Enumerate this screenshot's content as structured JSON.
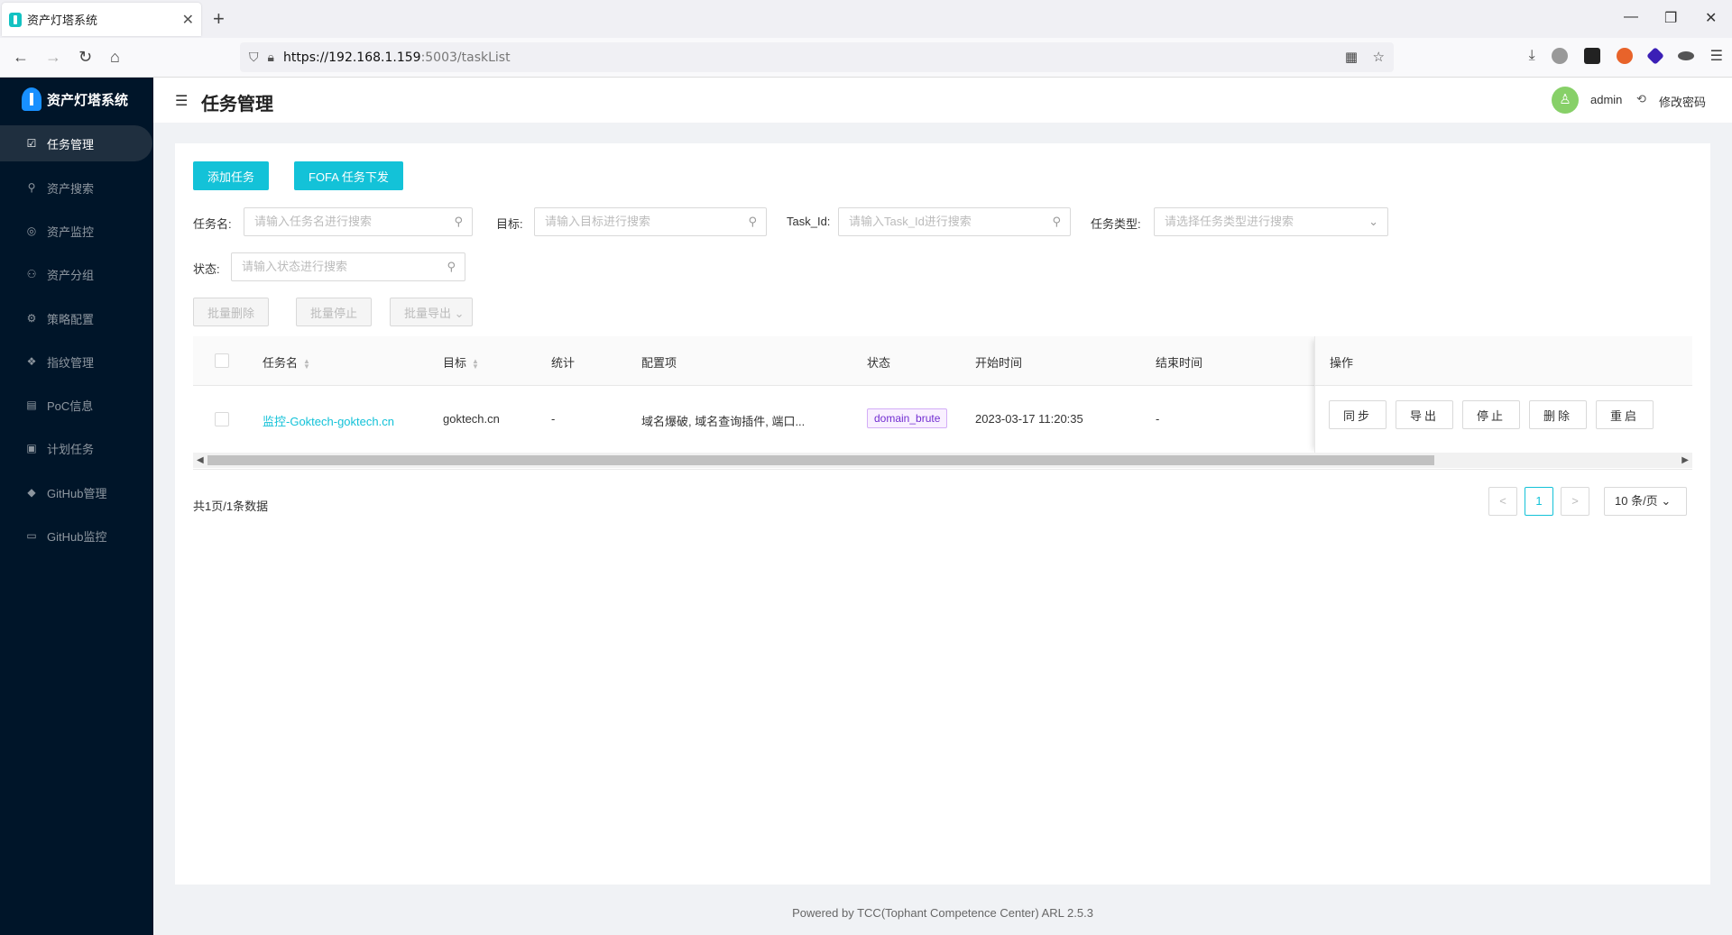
{
  "browser": {
    "tab_title": "资产灯塔系统",
    "url_host": "https://192.168.1.159",
    "url_rest": ":5003/taskList"
  },
  "sidebar": {
    "app_title": "资产灯塔系统",
    "items": [
      {
        "label": "任务管理",
        "icon": "☑"
      },
      {
        "label": "资产搜索",
        "icon": "⚲"
      },
      {
        "label": "资产监控",
        "icon": "◎"
      },
      {
        "label": "资产分组",
        "icon": "⚇"
      },
      {
        "label": "策略配置",
        "icon": "⚙"
      },
      {
        "label": "指纹管理",
        "icon": "❖"
      },
      {
        "label": "PoC信息",
        "icon": "▤"
      },
      {
        "label": "计划任务",
        "icon": "▣"
      },
      {
        "label": "GitHub管理",
        "icon": "◆"
      },
      {
        "label": "GitHub监控",
        "icon": "▭"
      }
    ]
  },
  "header": {
    "title": "任务管理",
    "user": "admin",
    "change_password": "修改密码"
  },
  "toolbar": {
    "add_task": "添加任务",
    "fofa_task": "FOFA 任务下发"
  },
  "filters": {
    "task_name_label": "任务名:",
    "task_name_placeholder": "请输入任务名进行搜索",
    "target_label": "目标:",
    "target_placeholder": "请输入目标进行搜索",
    "task_id_label": "Task_Id:",
    "task_id_placeholder": "请输入Task_Id进行搜索",
    "task_type_label": "任务类型:",
    "task_type_placeholder": "请选择任务类型进行搜索",
    "status_label": "状态:",
    "status_placeholder": "请输入状态进行搜索"
  },
  "batch": {
    "delete": "批量删除",
    "stop": "批量停止",
    "export": "批量导出"
  },
  "table": {
    "headers": {
      "name": "任务名",
      "target": "目标",
      "stats": "统计",
      "config": "配置项",
      "status": "状态",
      "start_time": "开始时间",
      "end_time": "结束时间",
      "actions": "操作"
    },
    "rows": [
      {
        "name": "监控-Goktech-goktech.cn",
        "target": "goktech.cn",
        "stats": "-",
        "config": "域名爆破, 域名查询插件, 端口...",
        "status": "domain_brute",
        "start_time": "2023-03-17 11:20:35",
        "end_time": "-"
      }
    ],
    "actions": [
      "同步",
      "导出",
      "停止",
      "删除",
      "重启"
    ]
  },
  "pagination": {
    "summary": "共1页/1条数据",
    "prev": "<",
    "current": "1",
    "next": ">",
    "page_size": "10 条/页"
  },
  "footer": "Powered by TCC(Tophant Competence Center) ARL 2.5.3",
  "colors": {
    "accent": "#13c2d8",
    "sidebar_bg": "#001529",
    "tag_purple": "#722ed1"
  }
}
